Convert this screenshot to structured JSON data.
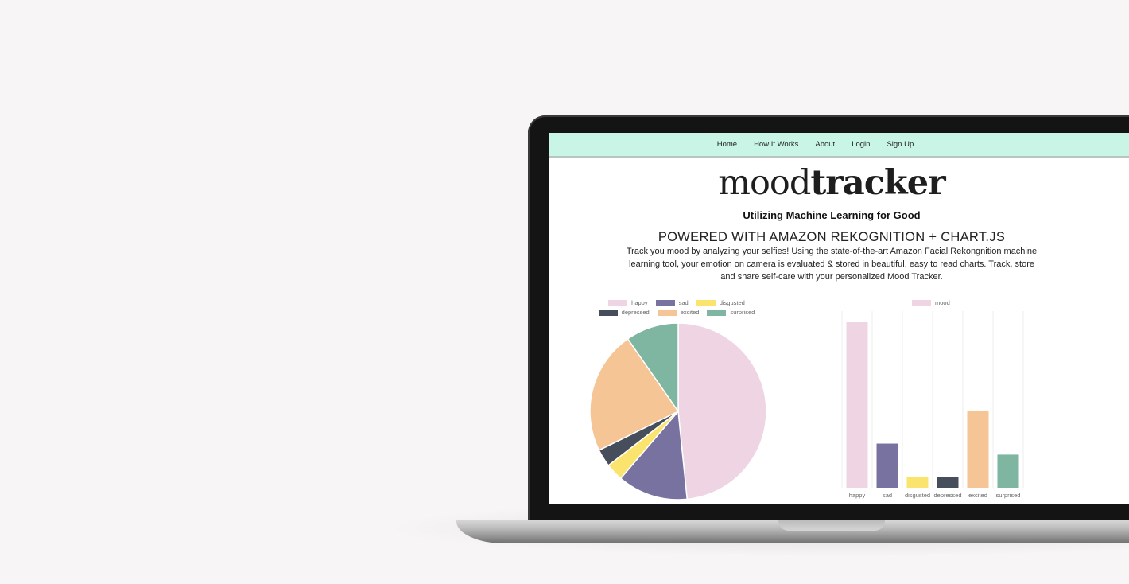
{
  "nav": {
    "items": [
      "Home",
      "How It Works",
      "About",
      "Login",
      "Sign Up"
    ]
  },
  "hero": {
    "logo_light": "mood",
    "logo_bold": "tracker",
    "tagline": "Utilizing Machine Learning for Good",
    "powered": "POWERED WITH AMAZON REKOGNITION + CHART.JS",
    "description": "Track you mood by analyzing your selfies! Using the state-of-the-art Amazon Facial Rekongnition machine learning tool, your emotion on camera is evaluated & stored in beautiful, easy to read charts. Track, store and share self-care with your personalized Mood Tracker."
  },
  "colors": {
    "happy": "#efd5e3",
    "sad": "#7872a1",
    "disgusted": "#fbe46d",
    "depressed": "#474e5b",
    "excited": "#f5c596",
    "surprised": "#7eb6a1",
    "navbar": "#c8f5e6"
  },
  "chart_data": [
    {
      "type": "pie",
      "legend_position": "top",
      "labels": [
        "happy",
        "sad",
        "disgusted",
        "depressed",
        "excited",
        "surprised"
      ],
      "values": [
        15,
        4,
        1,
        1,
        7,
        3
      ]
    },
    {
      "type": "bar",
      "legend_position": "top",
      "categories": [
        "happy",
        "sad",
        "disgusted",
        "depressed",
        "excited",
        "surprised"
      ],
      "series": [
        {
          "name": "mood",
          "values": [
            15,
            4,
            1,
            1,
            7,
            3
          ]
        }
      ],
      "ylim": [
        0,
        15
      ],
      "grid": true
    }
  ]
}
